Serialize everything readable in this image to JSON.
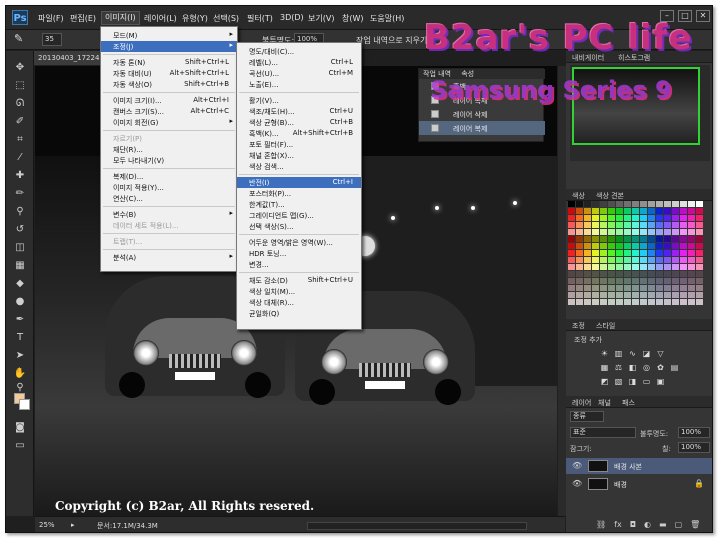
{
  "app": {
    "logo": "Ps"
  },
  "menubar": {
    "items": [
      "파일(F)",
      "편집(E)",
      "이미지(I)",
      "레이어(L)",
      "유형(Y)",
      "선택(S)",
      "필터(T)",
      "3D(D)",
      "보기(V)",
      "창(W)",
      "도움말(H)"
    ],
    "active_index": 2,
    "window_controls": [
      "–",
      "□",
      "✕"
    ]
  },
  "options_bar": {
    "brush_size": "35",
    "opacity_label": "불투명도:",
    "opacity_value": "100%",
    "history_text": "작업 내역으로 지우기"
  },
  "document": {
    "tab_title": "20130403_172241"
  },
  "image_menu": {
    "items": [
      {
        "label": "모드(M)",
        "shortcut": "",
        "submenu": true,
        "disabled": false
      },
      {
        "label": "조정(J)",
        "shortcut": "",
        "submenu": true,
        "disabled": false,
        "highlight": true
      },
      {
        "label": "자동 톤(N)",
        "shortcut": "Shift+Ctrl+L",
        "disabled": false
      },
      {
        "label": "자동 대비(U)",
        "shortcut": "Alt+Shift+Ctrl+L",
        "disabled": false
      },
      {
        "label": "자동 색상(O)",
        "shortcut": "Shift+Ctrl+B",
        "disabled": false
      },
      {
        "label": "이미지 크기(I)...",
        "shortcut": "Alt+Ctrl+I",
        "disabled": false
      },
      {
        "label": "캔버스 크기(S)...",
        "shortcut": "Alt+Ctrl+C",
        "disabled": false
      },
      {
        "label": "이미지 회전(G)",
        "shortcut": "",
        "submenu": true,
        "disabled": false
      },
      {
        "label": "자르기(P)",
        "shortcut": "",
        "disabled": true
      },
      {
        "label": "재단(R)...",
        "shortcut": "",
        "disabled": false
      },
      {
        "label": "모두 나타내기(V)",
        "shortcut": "",
        "disabled": false
      },
      {
        "label": "복제(D)...",
        "shortcut": "",
        "disabled": false
      },
      {
        "label": "이미지 적용(Y)...",
        "shortcut": "",
        "disabled": false
      },
      {
        "label": "연산(C)...",
        "shortcut": "",
        "disabled": false
      },
      {
        "label": "변수(B)",
        "shortcut": "",
        "submenu": true,
        "disabled": false
      },
      {
        "label": "데이터 세트 적용(L)...",
        "shortcut": "",
        "disabled": true
      },
      {
        "label": "트랩(T)...",
        "shortcut": "",
        "disabled": true
      },
      {
        "label": "분석(A)",
        "shortcut": "",
        "submenu": true,
        "disabled": false
      }
    ]
  },
  "adjust_menu": {
    "items": [
      {
        "label": "명도/대비(C)...",
        "shortcut": ""
      },
      {
        "label": "레벨(L)...",
        "shortcut": "Ctrl+L"
      },
      {
        "label": "곡선(U)...",
        "shortcut": "Ctrl+M"
      },
      {
        "label": "노출(E)...",
        "shortcut": ""
      },
      {
        "label": "활기(V)...",
        "shortcut": ""
      },
      {
        "label": "색조/채도(H)...",
        "shortcut": "Ctrl+U"
      },
      {
        "label": "색상 균형(B)...",
        "shortcut": "Ctrl+B"
      },
      {
        "label": "흑백(K)...",
        "shortcut": "Alt+Shift+Ctrl+B"
      },
      {
        "label": "포토 필터(F)...",
        "shortcut": ""
      },
      {
        "label": "채널 혼합(X)...",
        "shortcut": ""
      },
      {
        "label": "색상 검색...",
        "shortcut": ""
      },
      {
        "label": "반전(I)",
        "shortcut": "Ctrl+I",
        "highlight": true
      },
      {
        "label": "포스터화(P)...",
        "shortcut": ""
      },
      {
        "label": "한계값(T)...",
        "shortcut": ""
      },
      {
        "label": "그레이디언트 맵(G)...",
        "shortcut": ""
      },
      {
        "label": "선택 색상(S)...",
        "shortcut": ""
      },
      {
        "label": "어두운 영역/밝은 영역(W)...",
        "shortcut": ""
      },
      {
        "label": "HDR 토닝...",
        "shortcut": ""
      },
      {
        "label": "변경...",
        "shortcut": ""
      },
      {
        "label": "채도 감소(D)",
        "shortcut": "Shift+Ctrl+U"
      },
      {
        "label": "색상 일치(M)...",
        "shortcut": ""
      },
      {
        "label": "색상 대체(R)...",
        "shortcut": ""
      },
      {
        "label": "균일화(Q)",
        "shortcut": ""
      }
    ]
  },
  "history_panel": {
    "tabs": [
      "작업 내역",
      "속성"
    ],
    "rows": [
      "흑백",
      "레이어 복제",
      "레이어 삭제",
      "레이어 복제"
    ]
  },
  "navigator_panel": {
    "tabs": [
      "내비게이터",
      "히스토그램"
    ]
  },
  "swatches_panel": {
    "tabs": [
      "색상",
      "색상 견본"
    ]
  },
  "adjust_panel": {
    "tabs": [
      "조정",
      "스타일"
    ],
    "title": "조정 추가"
  },
  "layers_panel": {
    "tabs": [
      "레이어",
      "채널",
      "패스"
    ],
    "kind_label": "종류",
    "blend_mode": "표준",
    "opacity_label": "불투명도:",
    "opacity_value": "100%",
    "lock_label": "잠그기:",
    "fill_label": "칠:",
    "fill_value": "100%",
    "layers": [
      {
        "name": "배경 사본",
        "selected": true
      },
      {
        "name": "배경",
        "selected": false
      }
    ]
  },
  "status_bar": {
    "zoom": "25%",
    "doc_info": "문서:17.1M/34.3M"
  },
  "copyright": "Copyright (c) B2ar, All Rights resered.",
  "watermark": {
    "line1": "B2ar's PC life",
    "line2": "Samsung Series 9"
  },
  "colors": {
    "highlight": "#3d6fbe",
    "nav_frame": "#32d232",
    "fg_swatch": "#f4c99a"
  }
}
